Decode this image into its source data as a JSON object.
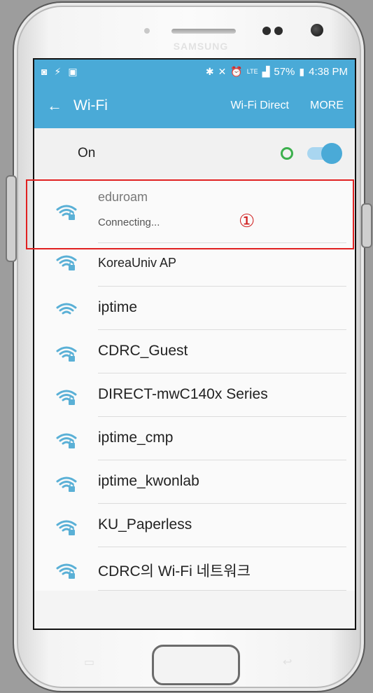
{
  "phone": {
    "brand": "SAMSUNG"
  },
  "status_bar": {
    "battery": "57%",
    "time": "4:38 PM",
    "network": "LTE"
  },
  "app_bar": {
    "title": "Wi-Fi",
    "wifi_direct": "Wi-Fi Direct",
    "more": "MORE"
  },
  "toggle": {
    "label": "On"
  },
  "networks": [
    {
      "name": "eduroam",
      "status": "Connecting...",
      "marker": "①",
      "secured": true
    },
    {
      "name": "KoreaUniv AP",
      "secured": true
    },
    {
      "name": "iptime",
      "secured": false
    },
    {
      "name": "CDRC_Guest",
      "secured": true
    },
    {
      "name": "DIRECT-mwC140x Series",
      "secured": true
    },
    {
      "name": "iptime_cmp",
      "secured": true
    },
    {
      "name": "iptime_kwonlab",
      "secured": true
    },
    {
      "name": "KU_Paperless",
      "secured": true
    },
    {
      "name": "CDRC의 Wi-Fi 네트워크",
      "secured": true
    }
  ],
  "colors": {
    "accent": "#4aaad7",
    "highlight": "#e02020",
    "connected": "#3cb04d"
  }
}
